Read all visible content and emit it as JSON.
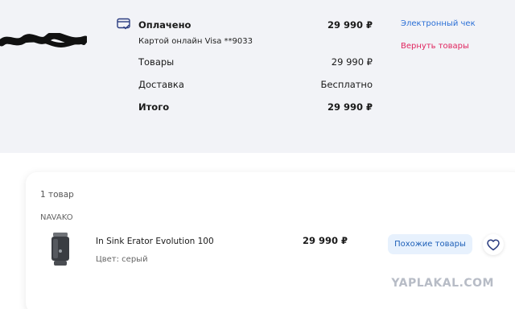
{
  "payment": {
    "status": "Оплачено",
    "method": "Картой онлайн Visa **9033",
    "amount": "29 990 ₽",
    "icon": "credit-card-check-icon"
  },
  "rows": [
    {
      "label": "Товары",
      "value": "29 990 ₽"
    },
    {
      "label": "Доставка",
      "value": "Бесплатно"
    },
    {
      "label": "Итого",
      "value": "29 990 ₽"
    }
  ],
  "links": {
    "receipt": "Электронный чек",
    "return": "Вернуть товары"
  },
  "order": {
    "items_count": "1 товар",
    "seller": "NAVAKO",
    "product": {
      "name": "In Sink Erator Evolution 100",
      "color": "Цвет: серый",
      "price": "29 990 ₽"
    },
    "similar_button": "Похожие товары",
    "favorite_icon": "heart-icon"
  },
  "watermark": "YAPLAKAL.COM",
  "colors": {
    "link_blue": "#2a6fd6",
    "link_pink": "#e0245e",
    "button_bg": "#e7f1fd",
    "panel_bg": "#f2f3f7"
  }
}
